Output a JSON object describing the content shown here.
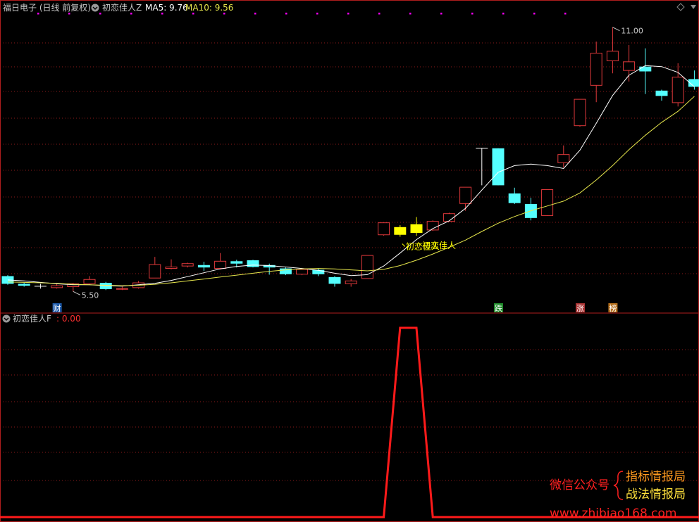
{
  "header": {
    "title": "福日电子 (日线 前复权)",
    "indicator_name": "初恋佳人Z",
    "ma5_label": "MA5: 9.76",
    "ma10_label": "MA10: 9.56"
  },
  "sub_header": {
    "indicator_name": "初恋佳人F",
    "value_label": ": 0.00"
  },
  "markers": {
    "high_label": "11.00",
    "low_label": "5.50",
    "signal_label": "初恋佳人",
    "badges": [
      {
        "text": "财",
        "color": "#1e5aa8",
        "index": 3
      },
      {
        "text": "跌",
        "color": "#1f8a2a",
        "index": 30
      },
      {
        "text": "涨",
        "color": "#a83232",
        "index": 35
      },
      {
        "text": "榜",
        "color": "#b5701e",
        "index": 37
      }
    ]
  },
  "watermark": {
    "left": "微信公众号",
    "line1": "指标情报局",
    "line2": "战法情报局",
    "url": "www.zhibiao168.com"
  },
  "colors": {
    "up": "#e0393b",
    "down": "#54ffff",
    "signal": "#ffff00",
    "ma5": "#ffffff",
    "ma10": "#e6e64c",
    "grid": "#8b1a1a",
    "indicator": "#ff1a1a",
    "label": "#c8c8c8"
  },
  "chart_data": [
    {
      "type": "candlestick",
      "title": "福日电子 (日线 前复权)",
      "ylim": [
        5.3,
        11.2
      ],
      "candles": [
        {
          "o": 5.82,
          "c": 5.66,
          "h": 5.84,
          "l": 5.64,
          "k": "down"
        },
        {
          "o": 5.66,
          "c": 5.62,
          "h": 5.68,
          "l": 5.6,
          "k": "down"
        },
        {
          "o": 5.61,
          "c": 5.61,
          "h": 5.66,
          "l": 5.56,
          "k": "flat"
        },
        {
          "o": 5.58,
          "c": 5.62,
          "h": 5.66,
          "l": 5.56,
          "k": "up"
        },
        {
          "o": 5.6,
          "c": 5.66,
          "h": 5.68,
          "l": 5.5,
          "k": "up"
        },
        {
          "o": 5.66,
          "c": 5.75,
          "h": 5.82,
          "l": 5.64,
          "k": "up"
        },
        {
          "o": 5.68,
          "c": 5.55,
          "h": 5.7,
          "l": 5.53,
          "k": "down"
        },
        {
          "o": 5.55,
          "c": 5.56,
          "h": 5.6,
          "l": 5.53,
          "k": "up"
        },
        {
          "o": 5.58,
          "c": 5.68,
          "h": 5.72,
          "l": 5.56,
          "k": "up"
        },
        {
          "o": 5.78,
          "c": 6.06,
          "h": 6.22,
          "l": 5.78,
          "k": "up"
        },
        {
          "o": 5.98,
          "c": 6.01,
          "h": 6.17,
          "l": 5.96,
          "k": "up"
        },
        {
          "o": 6.03,
          "c": 6.08,
          "h": 6.1,
          "l": 6.0,
          "k": "up"
        },
        {
          "o": 6.05,
          "c": 6.0,
          "h": 6.12,
          "l": 5.93,
          "k": "down"
        },
        {
          "o": 5.98,
          "c": 6.13,
          "h": 6.3,
          "l": 5.96,
          "k": "up"
        },
        {
          "o": 6.13,
          "c": 6.08,
          "h": 6.16,
          "l": 6.0,
          "k": "down"
        },
        {
          "o": 6.15,
          "c": 6.01,
          "h": 6.16,
          "l": 6.0,
          "k": "down"
        },
        {
          "o": 6.05,
          "c": 6.0,
          "h": 6.08,
          "l": 5.85,
          "k": "down"
        },
        {
          "o": 5.98,
          "c": 5.86,
          "h": 6.0,
          "l": 5.84,
          "k": "down"
        },
        {
          "o": 5.86,
          "c": 5.96,
          "h": 5.98,
          "l": 5.84,
          "k": "up"
        },
        {
          "o": 5.95,
          "c": 5.86,
          "h": 5.98,
          "l": 5.82,
          "k": "down"
        },
        {
          "o": 5.8,
          "c": 5.66,
          "h": 5.82,
          "l": 5.6,
          "k": "down"
        },
        {
          "o": 5.66,
          "c": 5.72,
          "h": 5.76,
          "l": 5.6,
          "k": "up"
        },
        {
          "o": 5.77,
          "c": 6.25,
          "h": 6.25,
          "l": 5.77,
          "k": "up"
        },
        {
          "o": 6.68,
          "c": 6.93,
          "h": 6.93,
          "l": 6.66,
          "k": "up"
        },
        {
          "o": 6.84,
          "c": 6.68,
          "h": 6.88,
          "l": 6.64,
          "k": "signal"
        },
        {
          "o": 6.72,
          "c": 6.9,
          "h": 7.05,
          "l": 6.66,
          "k": "signal"
        },
        {
          "o": 6.78,
          "c": 6.96,
          "h": 6.98,
          "l": 6.76,
          "k": "up"
        },
        {
          "o": 6.96,
          "c": 7.12,
          "h": 7.14,
          "l": 6.96,
          "k": "up"
        },
        {
          "o": 7.33,
          "c": 7.67,
          "h": 7.67,
          "l": 7.18,
          "k": "up"
        },
        {
          "o": 8.48,
          "c": 8.48,
          "h": 8.48,
          "l": 7.71,
          "k": "flat"
        },
        {
          "o": 8.48,
          "c": 7.71,
          "h": 8.48,
          "l": 7.71,
          "k": "down"
        },
        {
          "o": 7.54,
          "c": 7.34,
          "h": 7.66,
          "l": 7.32,
          "k": "down"
        },
        {
          "o": 7.32,
          "c": 7.03,
          "h": 7.45,
          "l": 6.98,
          "k": "down"
        },
        {
          "o": 7.08,
          "c": 7.62,
          "h": 7.62,
          "l": 7.07,
          "k": "up"
        },
        {
          "o": 8.18,
          "c": 8.35,
          "h": 8.54,
          "l": 8.08,
          "k": "up"
        },
        {
          "o": 8.95,
          "c": 9.5,
          "h": 9.5,
          "l": 8.93,
          "k": "up"
        },
        {
          "o": 9.79,
          "c": 10.46,
          "h": 10.7,
          "l": 9.44,
          "k": "up"
        },
        {
          "o": 10.3,
          "c": 10.5,
          "h": 11.0,
          "l": 10.04,
          "k": "up"
        },
        {
          "o": 10.1,
          "c": 10.28,
          "h": 10.63,
          "l": 9.87,
          "k": "up"
        },
        {
          "o": 10.18,
          "c": 10.08,
          "h": 10.56,
          "l": 9.61,
          "k": "down"
        },
        {
          "o": 9.68,
          "c": 9.57,
          "h": 9.7,
          "l": 9.47,
          "k": "down"
        },
        {
          "o": 9.43,
          "c": 9.96,
          "h": 10.25,
          "l": 9.35,
          "k": "up"
        },
        {
          "o": 9.92,
          "c": 9.76,
          "h": 10.1,
          "l": 9.7,
          "k": "down"
        }
      ],
      "ma5": [
        5.74,
        5.72,
        5.69,
        5.66,
        5.64,
        5.64,
        5.62,
        5.61,
        5.64,
        5.67,
        5.73,
        5.81,
        5.89,
        5.97,
        6.02,
        6.05,
        6.04,
        6.01,
        5.98,
        5.94,
        5.88,
        5.83,
        5.85,
        6.03,
        6.3,
        6.58,
        6.81,
        6.97,
        7.23,
        7.61,
        7.98,
        8.12,
        8.15,
        8.12,
        8.06,
        8.44,
        9.0,
        9.58,
        10.0,
        10.2,
        10.18,
        10.06,
        9.76
      ],
      "ma10": [
        5.7,
        5.69,
        5.68,
        5.67,
        5.65,
        5.64,
        5.63,
        5.62,
        5.63,
        5.65,
        5.68,
        5.72,
        5.76,
        5.8,
        5.84,
        5.88,
        5.92,
        5.95,
        5.97,
        5.98,
        5.97,
        5.95,
        5.93,
        5.96,
        6.04,
        6.15,
        6.28,
        6.42,
        6.57,
        6.75,
        6.92,
        7.06,
        7.18,
        7.28,
        7.38,
        7.55,
        7.82,
        8.12,
        8.45,
        8.75,
        9.02,
        9.25,
        9.56
      ]
    },
    {
      "type": "line",
      "title": "初恋佳人F",
      "ylim": [
        0,
        1
      ],
      "values": [
        0,
        0,
        0,
        0,
        0,
        0,
        0,
        0,
        0,
        0,
        0,
        0,
        0,
        0,
        0,
        0,
        0,
        0,
        0,
        0,
        0,
        0,
        0,
        0,
        1,
        1,
        0,
        0,
        0,
        0,
        0,
        0,
        0,
        0,
        0,
        0,
        0,
        0,
        0,
        0,
        0,
        0,
        0
      ]
    }
  ]
}
